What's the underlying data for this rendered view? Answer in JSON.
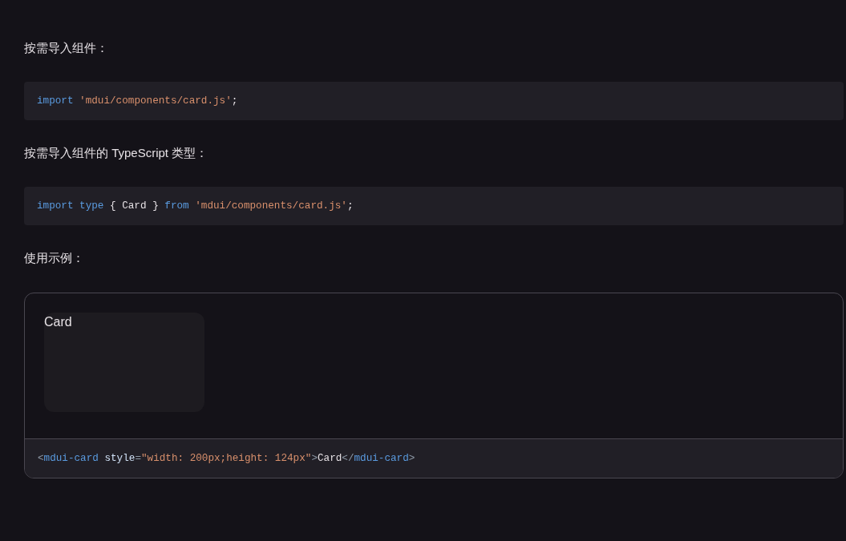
{
  "content": [
    {
      "kind": "paragraph",
      "text": "按需导入组件："
    },
    {
      "kind": "code",
      "tokens": [
        {
          "kind": "keyword",
          "text": "import "
        },
        {
          "kind": "string",
          "text": "'mdui/components/card.js'"
        },
        {
          "kind": "plain",
          "text": ";"
        }
      ]
    },
    {
      "kind": "paragraph",
      "text": "按需导入组件的 TypeScript 类型："
    },
    {
      "kind": "code",
      "tokens": [
        {
          "kind": "keyword",
          "text": "import type "
        },
        {
          "kind": "plain",
          "text": "{ Card } "
        },
        {
          "kind": "keyword",
          "text": "from "
        },
        {
          "kind": "string",
          "text": "'mdui/components/card.js'"
        },
        {
          "kind": "plain",
          "text": ";"
        }
      ]
    },
    {
      "kind": "paragraph",
      "text": "使用示例："
    },
    {
      "kind": "demo",
      "card": {
        "label": "Card"
      },
      "tokens": [
        {
          "kind": "punct",
          "text": "<"
        },
        {
          "kind": "tag",
          "text": "mdui-card "
        },
        {
          "kind": "attr",
          "text": "style"
        },
        {
          "kind": "punct",
          "text": "="
        },
        {
          "kind": "string",
          "text": "\"width: 200px;height: 124px\""
        },
        {
          "kind": "punct",
          "text": ">"
        },
        {
          "kind": "plain",
          "text": "Card"
        },
        {
          "kind": "punct",
          "text": "</"
        },
        {
          "kind": "tag",
          "text": "mdui-card"
        },
        {
          "kind": "punct",
          "text": ">"
        }
      ]
    }
  ]
}
